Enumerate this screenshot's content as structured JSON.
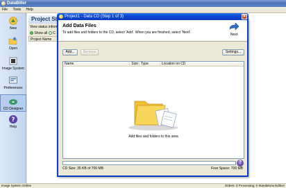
{
  "app": {
    "title": "DataBiller"
  },
  "menu": [
    "File",
    "Tools",
    "Help"
  ],
  "sidebar": {
    "items": [
      {
        "label": "New"
      },
      {
        "label": "Open"
      },
      {
        "label": "Image System"
      },
      {
        "label": "Preferences"
      },
      {
        "label": "CD Designer"
      },
      {
        "label": "Help"
      }
    ]
  },
  "project": {
    "title": "Project Sta",
    "status": "View status informa",
    "show_all": "Show all",
    "show_other": "C",
    "column": "Project Name"
  },
  "statusbar": {
    "left": "Image System Online",
    "right": "Orders:  0   Processing:  0     Standalone Edition"
  },
  "dialog": {
    "title": "Project1 - Data CD (Step 1 of 3)",
    "heading": "Add Data Files",
    "description": "To add files and folders to the CD, select 'Add'. When you are finished, select 'Next'.",
    "next_label": "Next",
    "buttons": {
      "add": "Add...",
      "remove": "Remove",
      "settings": "Settings..."
    },
    "columns": [
      "Name",
      "Size",
      "Type",
      "Location on CD"
    ],
    "empty_text": "Add files and folders to this area",
    "cd_size": "CD Size: 35 KB of 700 MB",
    "free_space": "Free Space: 700 MB",
    "progress_fraction": 0.0,
    "accent": "#0a3fc4"
  }
}
